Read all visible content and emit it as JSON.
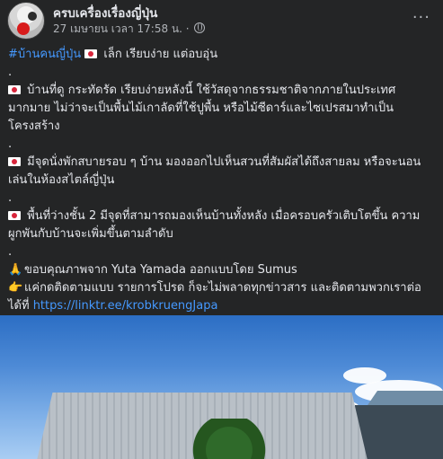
{
  "post": {
    "page_name": "ครบเครื่องเรื่องญี่ปุ่น",
    "timestamp": "27 เมษายน เวลา 17:58 น.",
    "separator": " · ",
    "hashtag": "#บ้านคนญี่ปุ่น",
    "title": " เล็ก เรียบง่าย แต่อบอุ่น",
    "paragraph_1": "บ้านที่ดู กระทัดรัด เรียบง่ายหลังนี้ ใช้วัสดุจากธรรมชาติจากภายในประเทศมากมาย ไม่ว่าจะเป็นพื้นไม้เกาลัดที่ใช้ปูพื้น หรือไม้ซีดาร์และไซเปรสมาทำเป็นโครงสร้าง",
    "paragraph_2": "มีจุดนั่งพักสบายรอบ ๆ บ้าน มองออกไปเห็นสวนที่สัมผัสได้ถึงสายลม หรือจะนอนเล่นในห้องสไตล์ญี่ปุ่น",
    "paragraph_3": "พื้นที่ว่างชั้น 2 มีจุดที่สามารถมองเห็นบ้านทั้งหลัง เมื่อครอบครัวเติบโตขึ้น ความผูกพันกับบ้านจะเพิ่มขึ้นตามลำดับ",
    "credit": "ขอบคุณภาพจาก Yuta Yamada ออกแบบโดย Sumus",
    "follow": "แค่กดติดตามแบบ รายการโปรด ก็จะไม่พลาดทุกข่าวสาร และติดตามพวกเราต่อได้ที่ ",
    "link": "https://linktr.ee/krobkruengJapa",
    "dot": "."
  },
  "icons": {
    "flag": "japan-flag-icon",
    "pray": "pray-icon",
    "point": "point-right-icon",
    "globe": "globe-icon",
    "more": "more-options-icon"
  },
  "more_label": "···"
}
